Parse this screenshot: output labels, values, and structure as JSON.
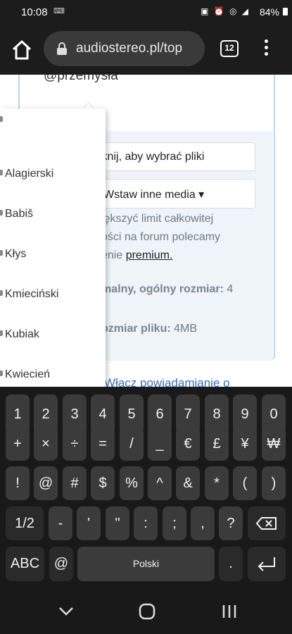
{
  "status_bar": {
    "time": "10:08",
    "keyboard_indicator": "⌨",
    "system_icons": "▣ ⏰ ◎ ◢",
    "battery": "84%"
  },
  "browser": {
    "url": "audiostereo.pl/top",
    "tab_count": "12"
  },
  "page": {
    "mention_text": "@przemysła",
    "file_button_label": "iknij, aby wybrać pliki",
    "media_button_label": "Wstaw inne media ▾",
    "info_line1": "iększyć limit całkowitej",
    "info_line2": "ości na forum polecamy",
    "info_line3_prefix": "enie ",
    "info_line3_link": "premium.",
    "max_total_label": "malny, ogólny rozmiar:",
    "max_total_value": " 4",
    "max_file_label": "ozmiar pliku:",
    "max_file_value": " 4MB",
    "notify_link": "Włącz powiadamianie o"
  },
  "dropdown": {
    "items": [
      {
        "label": ""
      },
      {
        "label": "Alagierski"
      },
      {
        "label": "Babiš"
      },
      {
        "label": "Kłys"
      },
      {
        "label": "Kmieciński"
      },
      {
        "label": "Kubiak"
      },
      {
        "label": "Kwiecień"
      }
    ]
  },
  "keyboard": {
    "row1": [
      "1",
      "2",
      "3",
      "4",
      "5",
      "6",
      "7",
      "8",
      "9",
      "0"
    ],
    "row2": [
      "+",
      "×",
      "÷",
      "=",
      "/",
      "_",
      "€",
      "£",
      "¥",
      "₩"
    ],
    "row3": [
      "!",
      "@",
      "#",
      "$",
      "%",
      "^",
      "&",
      "*",
      "(",
      ")"
    ],
    "row4": [
      "1/2",
      "-",
      "'",
      "\"",
      ":",
      ";",
      ",",
      "?"
    ],
    "row5": {
      "abc": "ABC",
      "at": "@",
      "space": "Polski",
      "dot": "."
    }
  },
  "colors": {
    "accent_link": "#3b6fb6",
    "card_border": "#b9d7ef",
    "upload_bg": "#eef4f8"
  }
}
